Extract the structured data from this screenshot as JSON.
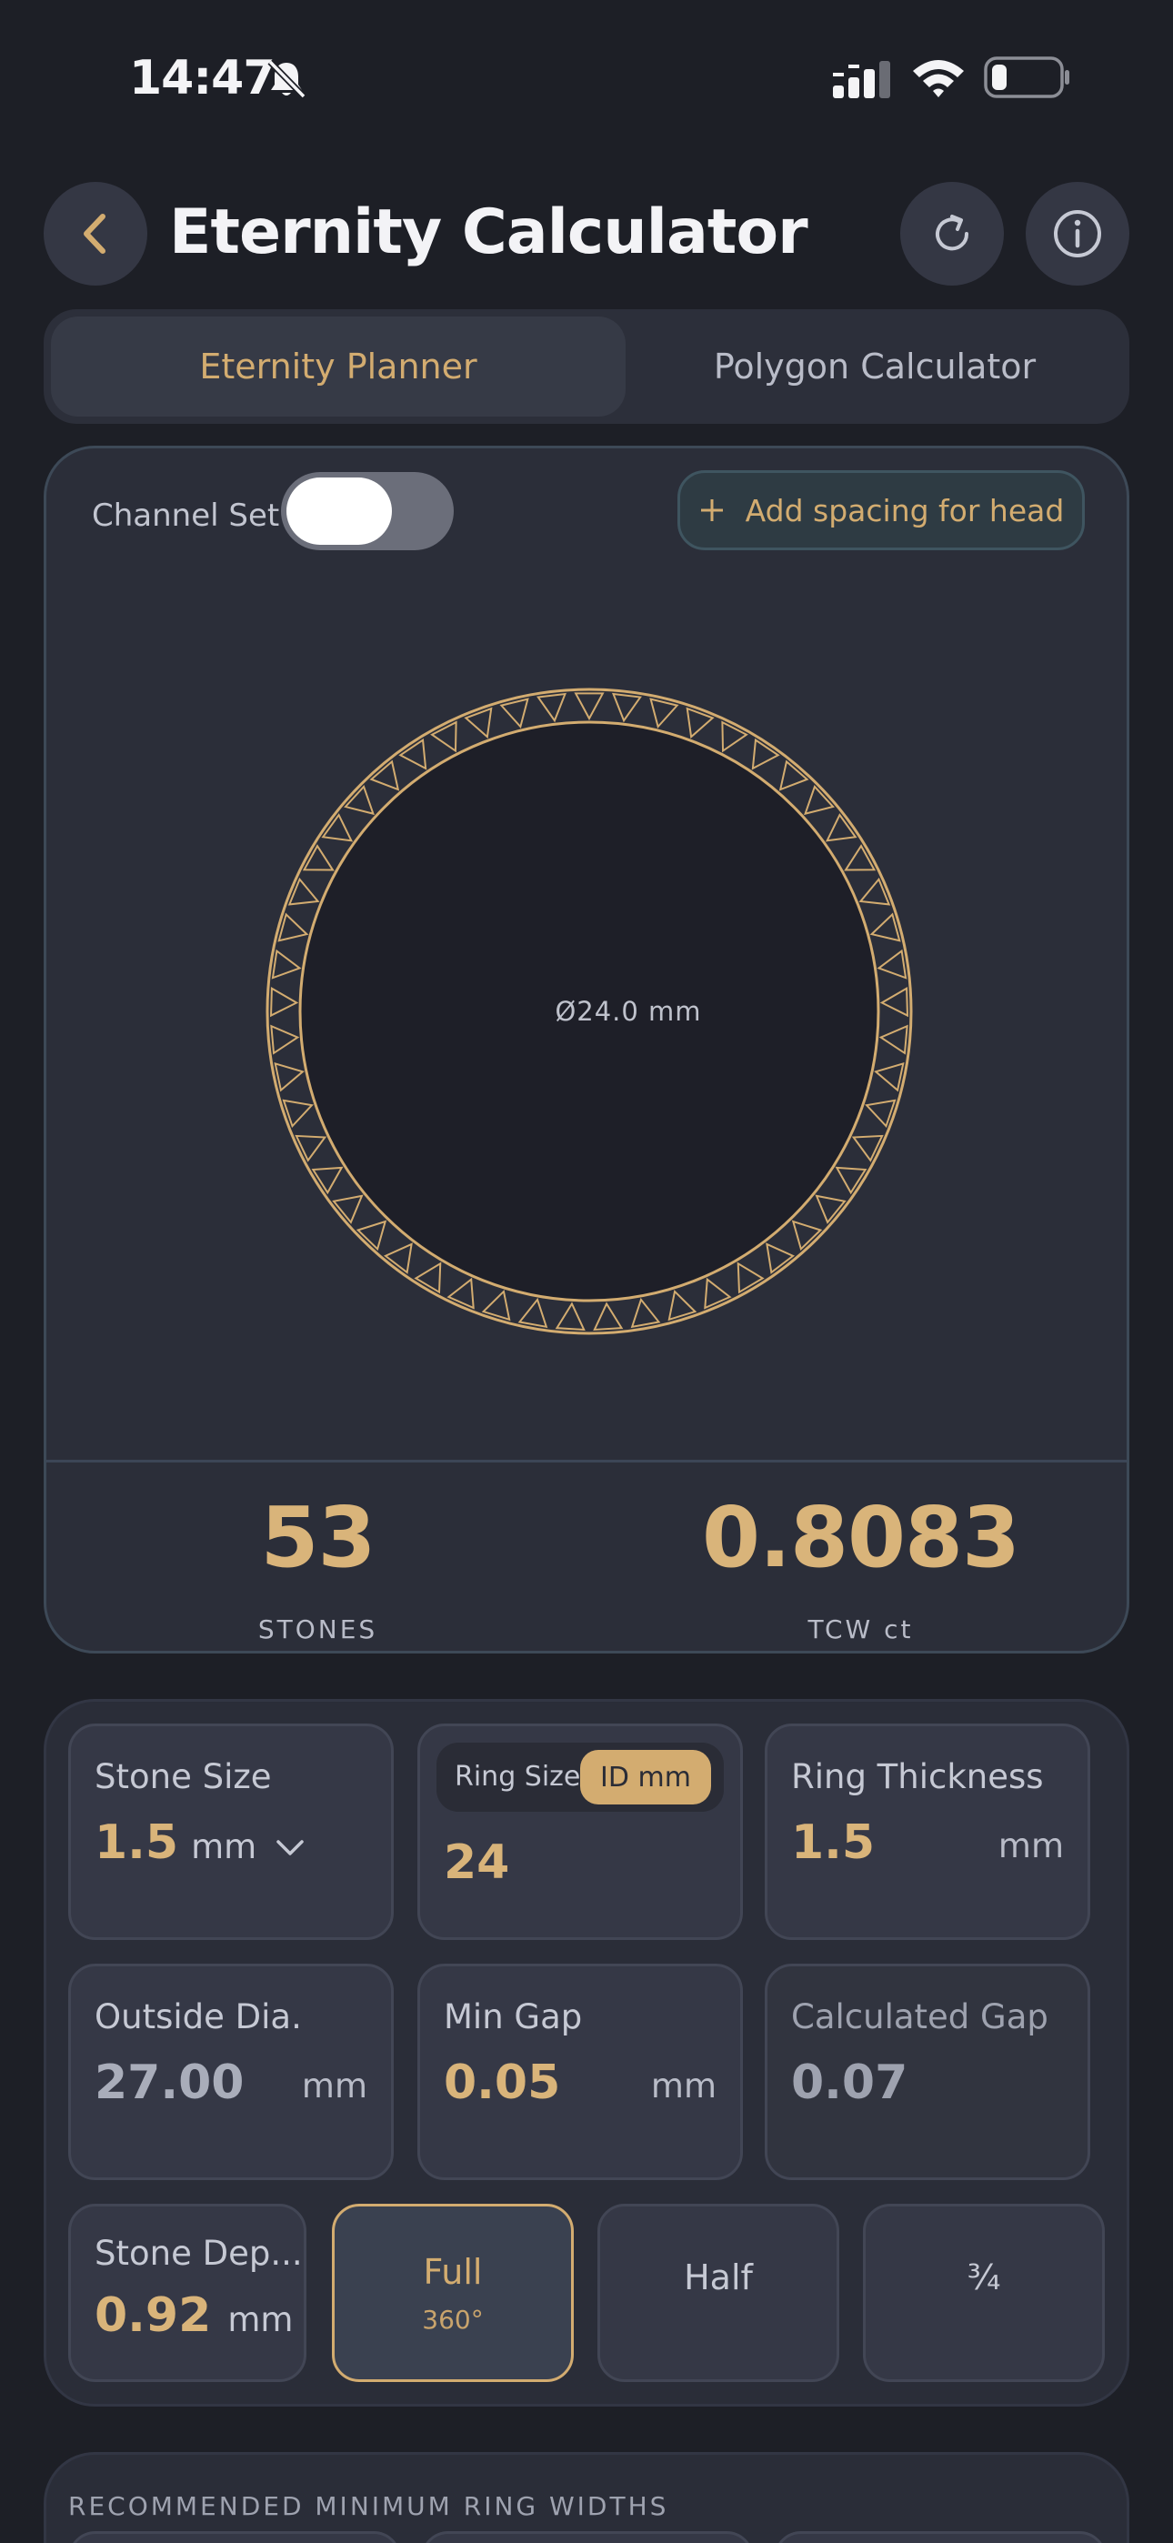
{
  "status_bar": {
    "time": "14:47",
    "icons": [
      "bell-slash-icon",
      "signal-icon",
      "wifi-icon",
      "battery-icon"
    ]
  },
  "header": {
    "title": "Eternity Calculator",
    "back_icon": "chevron-left-icon",
    "refresh_icon": "refresh-icon",
    "info_icon": "info-icon"
  },
  "tabs": [
    {
      "label": "Eternity Planner",
      "active": true
    },
    {
      "label": "Polygon Calculator",
      "active": false
    }
  ],
  "planner": {
    "channel_set_label": "Channel Set",
    "channel_set_on": false,
    "add_head_label": "Add spacing for head",
    "diameter_label": "Ø24.0 mm",
    "stones_value": "53",
    "stones_label": "STONES",
    "tcw_value": "0.8083",
    "tcw_label": "TCW ct"
  },
  "inputs": {
    "stone_size": {
      "label": "Stone Size",
      "value": "1.5",
      "unit": "mm"
    },
    "ring_size": {
      "toggle_left": "Ring Size",
      "toggle_right": "ID mm",
      "value": "24"
    },
    "ring_thickness": {
      "label": "Ring Thickness",
      "value": "1.5",
      "unit": "mm"
    },
    "outside_dia": {
      "label": "Outside Dia.",
      "value": "27.00",
      "unit": "mm"
    },
    "min_gap": {
      "label": "Min Gap",
      "value": "0.05",
      "unit": "mm"
    },
    "calculated_gap": {
      "label": "Calculated Gap",
      "value": "0.07"
    },
    "stone_depth": {
      "label": "Stone Dep...",
      "value": "0.92",
      "unit": "mm"
    },
    "coverage": [
      {
        "label": "Full",
        "sub": "360°",
        "selected": true
      },
      {
        "label": "Half",
        "sub": "",
        "selected": false
      },
      {
        "label": "¾",
        "sub": "",
        "selected": false
      }
    ]
  },
  "recommended": {
    "title": "RECOMMENDED MINIMUM RING WIDTHS"
  },
  "colors": {
    "background": "#1d1f26",
    "card": "#2b2e39",
    "accent_gold": "#d3ac70",
    "stat_gold": "#d9b47a"
  }
}
